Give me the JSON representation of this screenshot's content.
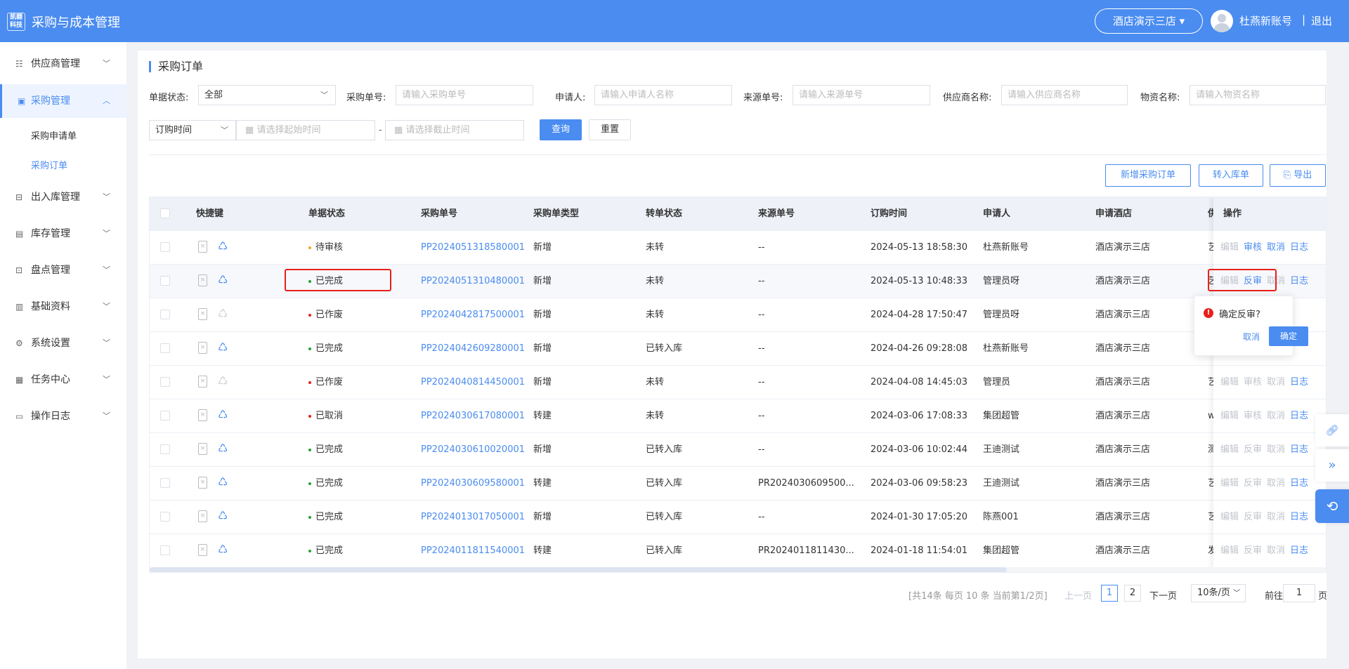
{
  "header": {
    "logo_line1": "凯翱",
    "logo_line2": "科技",
    "app_title": "采购与成本管理",
    "store": "酒店演示三店",
    "username": "杜燕新账号",
    "separator": "|",
    "logout": "退出"
  },
  "sidebar": {
    "items": [
      {
        "label": "供应商管理"
      },
      {
        "label": "采购管理"
      },
      {
        "label": "出入库管理"
      },
      {
        "label": "库存管理"
      },
      {
        "label": "盘点管理"
      },
      {
        "label": "基础资料"
      },
      {
        "label": "系统设置"
      },
      {
        "label": "任务中心"
      },
      {
        "label": "操作日志"
      }
    ],
    "sub_items": [
      {
        "label": "采购申请单"
      },
      {
        "label": "采购订单"
      }
    ]
  },
  "page": {
    "title": "采购订单"
  },
  "filters": {
    "status_label": "单据状态:",
    "status_value": "全部",
    "po_label": "采购单号:",
    "po_placeholder": "请输入采购单号",
    "applicant_label": "申请人:",
    "applicant_placeholder": "请输入申请人名称",
    "source_label": "来源单号:",
    "source_placeholder": "请输入来源单号",
    "supplier_label": "供应商名称:",
    "supplier_placeholder": "请输入供应商名称",
    "material_label": "物资名称:",
    "material_placeholder": "请输入物资名称",
    "date_type": "订购时间",
    "start_placeholder": "请选择起始时间",
    "dash": "-",
    "end_placeholder": "请选择截止时间",
    "query": "查询",
    "reset": "重置"
  },
  "actions": {
    "add": "新增采购订单",
    "to_stock": "转入库单",
    "export": "导出"
  },
  "table": {
    "headers": [
      "快捷键",
      "单据状态",
      "采购单号",
      "采购单类型",
      "转单状态",
      "来源单号",
      "订购时间",
      "申请人",
      "申请酒店",
      "供",
      "操作"
    ],
    "rows": [
      {
        "status": "待审核",
        "status_color": "#f5a623",
        "po": "PP2024051318580001",
        "type": "新增",
        "transfer": "未转",
        "source": "--",
        "time": "2024-05-13 18:58:30",
        "applicant": "杜燕新账号",
        "hotel": "酒店演示三店",
        "supplier": "艺",
        "ops": [
          "编辑",
          "审核",
          "取消",
          "日志"
        ],
        "ops_enabled": [
          false,
          true,
          true,
          true
        ],
        "rec_enabled": true
      },
      {
        "status": "已完成",
        "status_color": "#21a336",
        "po": "PP2024051310480001",
        "type": "新增",
        "transfer": "未转",
        "source": "--",
        "time": "2024-05-13 10:48:33",
        "applicant": "管理员呀",
        "hotel": "酒店演示三店",
        "supplier": "艺",
        "ops": [
          "编辑",
          "反审",
          "取消",
          "日志"
        ],
        "ops_enabled": [
          false,
          true,
          false,
          true
        ],
        "rec_enabled": true
      },
      {
        "status": "已作废",
        "status_color": "#e8201a",
        "po": "PP2024042817500001",
        "type": "新增",
        "transfer": "未转",
        "source": "--",
        "time": "2024-04-28 17:50:47",
        "applicant": "管理员呀",
        "hotel": "酒店演示三店",
        "supplier": "",
        "ops": [],
        "ops_enabled": [],
        "rec_enabled": false
      },
      {
        "status": "已完成",
        "status_color": "#21a336",
        "po": "PP2024042609280001",
        "type": "新增",
        "transfer": "已转入库",
        "source": "--",
        "time": "2024-04-26 09:28:08",
        "applicant": "杜燕新账号",
        "hotel": "酒店演示三店",
        "supplier": "",
        "ops": [],
        "ops_enabled": [],
        "rec_enabled": true
      },
      {
        "status": "已作废",
        "status_color": "#e8201a",
        "po": "PP2024040814450001",
        "type": "新增",
        "transfer": "未转",
        "source": "--",
        "time": "2024-04-08 14:45:03",
        "applicant": "管理员",
        "hotel": "酒店演示三店",
        "supplier": "艺",
        "ops": [
          "编辑",
          "审核",
          "取消",
          "日志"
        ],
        "ops_enabled": [
          false,
          false,
          false,
          true
        ],
        "rec_enabled": false
      },
      {
        "status": "已取消",
        "status_color": "#e8201a",
        "po": "PP2024030617080001",
        "type": "转建",
        "transfer": "未转",
        "source": "--",
        "time": "2024-03-06 17:08:33",
        "applicant": "集团超管",
        "hotel": "酒店演示三店",
        "supplier": "w",
        "ops": [
          "编辑",
          "审核",
          "取消",
          "日志"
        ],
        "ops_enabled": [
          false,
          false,
          false,
          true
        ],
        "rec_enabled": true
      },
      {
        "status": "已完成",
        "status_color": "#21a336",
        "po": "PP2024030610020001",
        "type": "新增",
        "transfer": "已转入库",
        "source": "--",
        "time": "2024-03-06 10:02:44",
        "applicant": "王迪测试",
        "hotel": "酒店演示三店",
        "supplier": "测",
        "ops": [
          "编辑",
          "反审",
          "取消",
          "日志"
        ],
        "ops_enabled": [
          false,
          false,
          false,
          true
        ],
        "rec_enabled": true
      },
      {
        "status": "已完成",
        "status_color": "#21a336",
        "po": "PP2024030609580001",
        "type": "转建",
        "transfer": "已转入库",
        "source": "PR2024030609500...",
        "time": "2024-03-06 09:58:23",
        "applicant": "王迪测试",
        "hotel": "酒店演示三店",
        "supplier": "艺",
        "ops": [
          "编辑",
          "反审",
          "取消",
          "日志"
        ],
        "ops_enabled": [
          false,
          false,
          false,
          true
        ],
        "rec_enabled": true
      },
      {
        "status": "已完成",
        "status_color": "#21a336",
        "po": "PP2024013017050001",
        "type": "新增",
        "transfer": "已转入库",
        "source": "--",
        "time": "2024-01-30 17:05:20",
        "applicant": "陈燕001",
        "hotel": "酒店演示三店",
        "supplier": "艺",
        "ops": [
          "编辑",
          "反审",
          "取消",
          "日志"
        ],
        "ops_enabled": [
          false,
          false,
          false,
          true
        ],
        "rec_enabled": true
      },
      {
        "status": "已完成",
        "status_color": "#21a336",
        "po": "PP2024011811540001",
        "type": "转建",
        "transfer": "已转入库",
        "source": "PR2024011811430...",
        "time": "2024-01-18 11:54:01",
        "applicant": "集团超管",
        "hotel": "酒店演示三店",
        "supplier": "发",
        "ops": [
          "编辑",
          "反审",
          "取消",
          "日志"
        ],
        "ops_enabled": [
          false,
          false,
          false,
          true
        ],
        "rec_enabled": true
      }
    ]
  },
  "popover": {
    "icon": "!",
    "text": "确定反审?",
    "cancel": "取消",
    "confirm": "确定"
  },
  "pagination": {
    "info": "[共14条 每页 10 条 当前第1/2页]",
    "prev": "上一页",
    "pages": [
      "1",
      "2"
    ],
    "current": "1",
    "next": "下一页",
    "size": "10条/页",
    "goto": "前往",
    "goto_value": "1",
    "page_unit": "页"
  },
  "icons": {
    "doc": "document-x-icon",
    "recycle": "recycle-icon",
    "link": "link-icon",
    "collapse": "double-chevron-right-icon",
    "support": "headset-icon"
  }
}
